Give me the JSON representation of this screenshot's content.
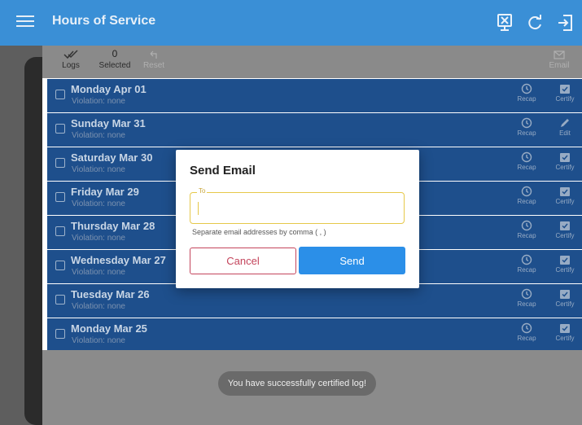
{
  "appbar": {
    "title": "Hours of Service",
    "icons": [
      "menu-icon",
      "dot-export-icon",
      "refresh-icon",
      "logout-icon"
    ]
  },
  "toolbar": {
    "logs_label": "Logs",
    "selected_count": "0",
    "selected_label": "Selected",
    "reset_label": "Reset",
    "email_label": "Email"
  },
  "logs": [
    {
      "day": "Monday Apr 01",
      "violation": "Violation: none",
      "left_label": "Recap",
      "right_label": "Certify",
      "right_icon": "certify-icon"
    },
    {
      "day": "Sunday Mar 31",
      "violation": "Violation: none",
      "left_label": "Recap",
      "right_label": "Edit",
      "right_icon": "edit-icon"
    },
    {
      "day": "Saturday Mar 30",
      "violation": "Violation: none",
      "left_label": "Recap",
      "right_label": "Certify",
      "right_icon": "certify-icon"
    },
    {
      "day": "Friday Mar 29",
      "violation": "Violation: none",
      "left_label": "Recap",
      "right_label": "Certify",
      "right_icon": "certify-icon"
    },
    {
      "day": "Thursday Mar 28",
      "violation": "Violation: none",
      "left_label": "Recap",
      "right_label": "Certify",
      "right_icon": "certify-icon"
    },
    {
      "day": "Wednesday Mar 27",
      "violation": "Violation: none",
      "left_label": "Recap",
      "right_label": "Certify",
      "right_icon": "certify-icon"
    },
    {
      "day": "Tuesday Mar 26",
      "violation": "Violation: none",
      "left_label": "Recap",
      "right_label": "Certify",
      "right_icon": "certify-icon"
    },
    {
      "day": "Monday Mar 25",
      "violation": "Violation: none",
      "left_label": "Recap",
      "right_label": "Certify",
      "right_icon": "certify-icon"
    }
  ],
  "dialog": {
    "title": "Send Email",
    "to_label": "To",
    "to_value": "",
    "hint": "Separate email addresses by comma ( , )",
    "cancel_label": "Cancel",
    "send_label": "Send"
  },
  "toast": "You have successfully certified log!",
  "colors": {
    "appbar": "#3a8fd6",
    "row": "#1e4f8c",
    "field_accent": "#e6c84a",
    "cancel": "#c4455c",
    "send": "#2b8fe8"
  }
}
